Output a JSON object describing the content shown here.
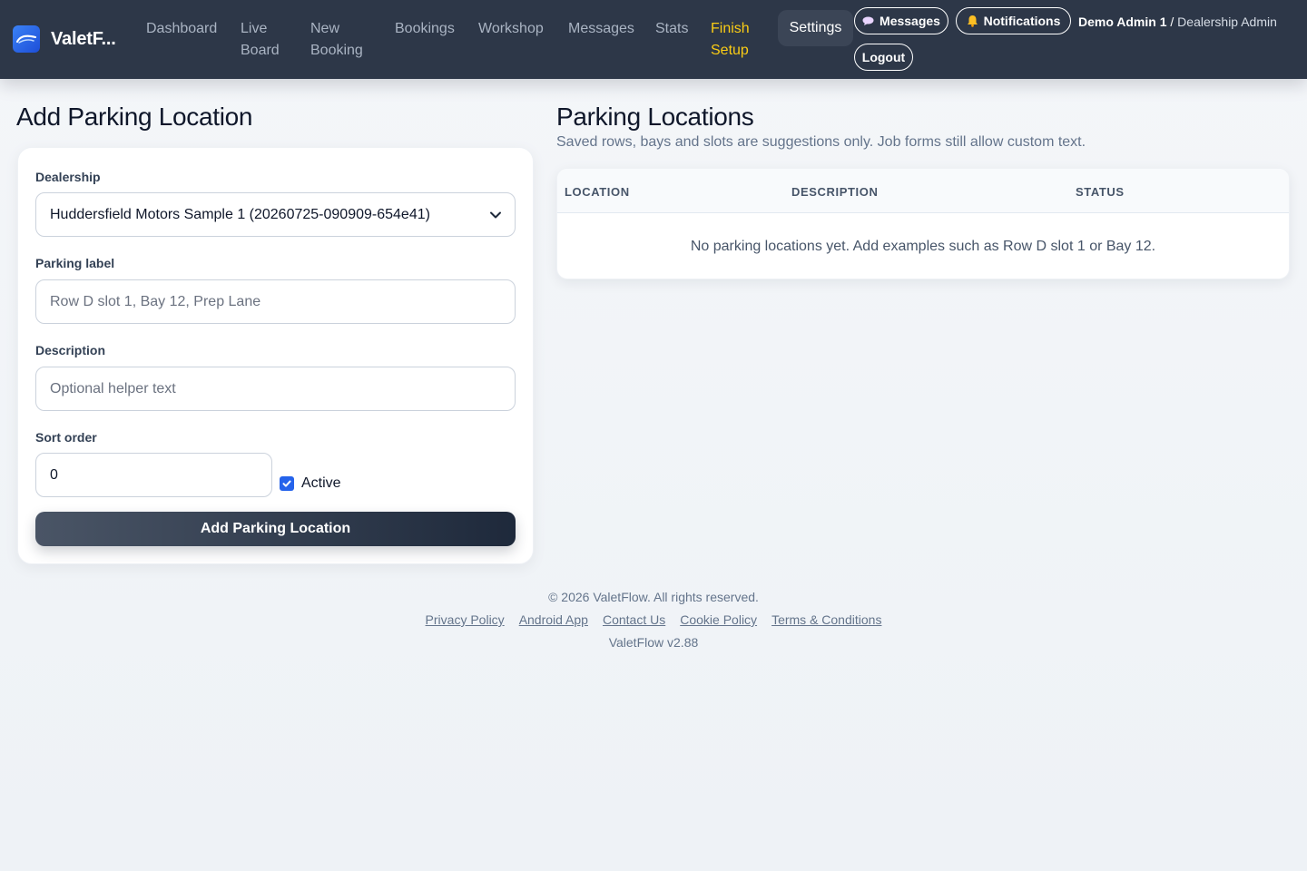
{
  "header": {
    "brand": "ValetF...",
    "nav": {
      "dashboard": "Dashboard",
      "live_board_1": "Live",
      "live_board_2": "Board",
      "new_booking_1": "New",
      "new_booking_2": "Booking",
      "bookings": "Bookings",
      "workshop": "Workshop",
      "messages": "Messages",
      "stats": "Stats",
      "finish_setup_1": "Finish",
      "finish_setup_2": "Setup",
      "settings": "Settings"
    },
    "messages_button": "Messages",
    "notifications_button": "Notifications",
    "logout_button": "Logout",
    "user_name": "Demo Admin 1",
    "user_separator": " / ",
    "user_role": "Dealership Admin",
    "colors": {
      "background": "#2d3748",
      "accent": "#facc15"
    }
  },
  "form": {
    "title": "Add Parking Location",
    "dealership_label": "Dealership",
    "dealership_value": "Huddersfield Motors Sample 1 (20260725-090909-654e41)",
    "parking_label_label": "Parking label",
    "parking_label_placeholder": "Row D slot 1, Bay 12, Prep Lane",
    "description_label": "Description",
    "description_placeholder": "Optional helper text",
    "sort_order_label": "Sort order",
    "sort_order_value": "0",
    "active_label": "Active",
    "active_checked": true,
    "submit_label": "Add Parking Location"
  },
  "locations": {
    "title": "Parking Locations",
    "subtitle": "Saved rows, bays and slots are suggestions only. Job forms still allow custom text.",
    "columns": [
      "LOCATION",
      "DESCRIPTION",
      "STATUS"
    ],
    "empty_message": "No parking locations yet. Add examples such as Row D slot 1 or Bay 12."
  },
  "footer": {
    "copyright": "© 2026 ValetFlow. All rights reserved.",
    "links": [
      "Privacy Policy",
      "Android App",
      "Contact Us",
      "Cookie Policy",
      "Terms & Conditions"
    ],
    "version": "ValetFlow v2.88"
  }
}
